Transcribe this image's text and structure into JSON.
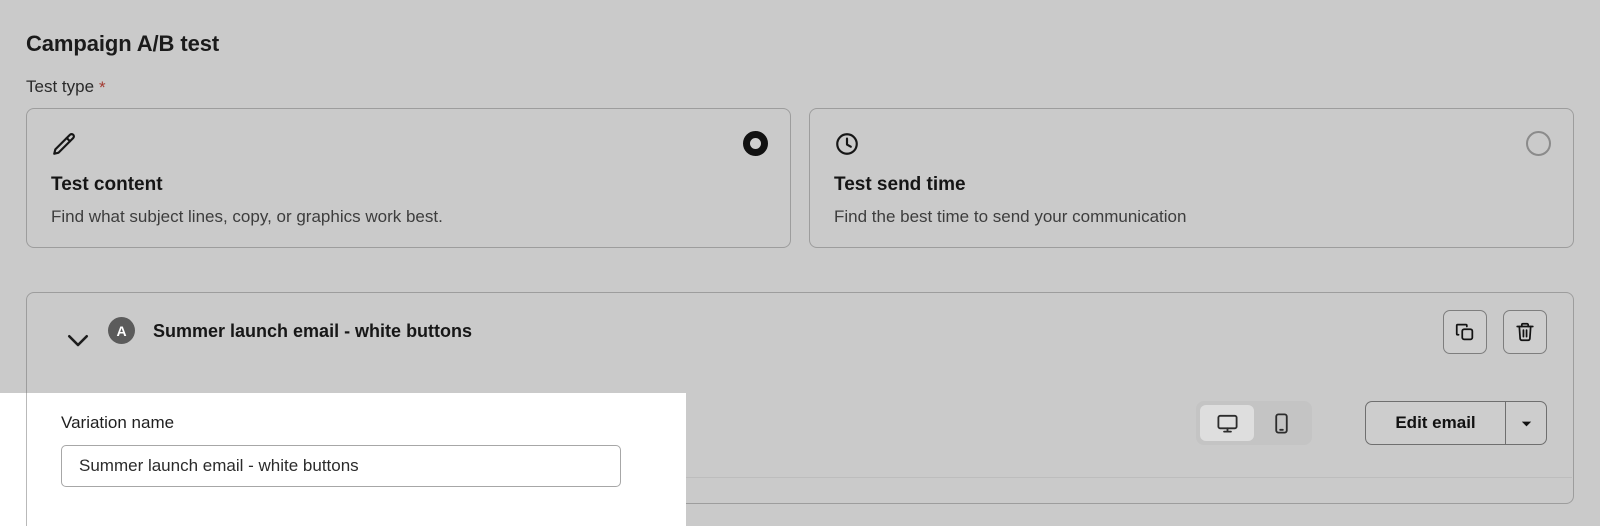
{
  "page": {
    "title": "Campaign A/B test",
    "test_type_label": "Test type",
    "required_marker": "*",
    "required_color": "#a33a31",
    "background_color": "#cacaca"
  },
  "test_type": {
    "options": [
      {
        "icon": "pencil-icon",
        "title": "Test content",
        "description": "Find what subject lines, copy, or graphics work best.",
        "selected": true
      },
      {
        "icon": "clock-icon",
        "title": "Test send time",
        "description": "Find the best time to send your communication",
        "selected": false
      }
    ]
  },
  "variation": {
    "collapse_icon": "chevron-down-icon",
    "badge_letter": "A",
    "title": "Summer launch email - white buttons",
    "duplicate_icon": "copy-icon",
    "delete_icon": "trash-icon",
    "preview_modes": [
      {
        "icon": "desktop-icon",
        "active": true
      },
      {
        "icon": "mobile-icon",
        "active": false
      }
    ],
    "edit_button_label": "Edit email",
    "edit_dropdown_icon": "caret-down-icon"
  },
  "overlay": {
    "label": "Variation name",
    "input_value": "Summer launch email - white buttons",
    "input_placeholder": "Variation name"
  }
}
